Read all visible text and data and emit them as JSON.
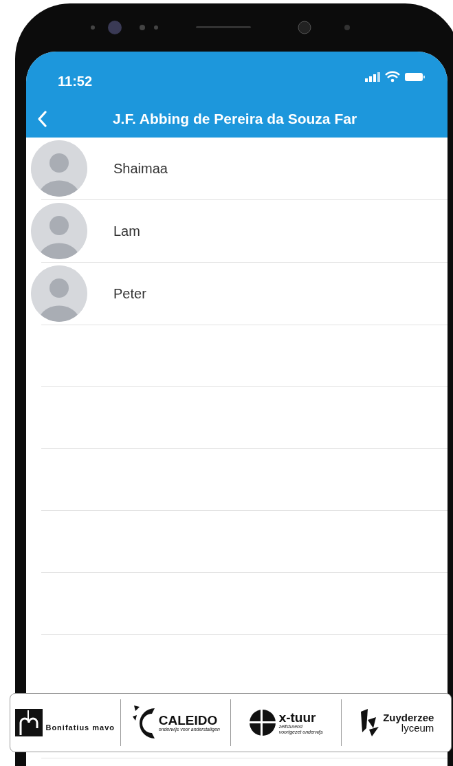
{
  "status_bar": {
    "time": "11:52"
  },
  "nav_bar": {
    "title": "J.F. Abbing de Pereira da Souza Far"
  },
  "contacts": [
    {
      "name": "Shaimaa"
    },
    {
      "name": "Lam"
    },
    {
      "name": "Peter"
    }
  ],
  "logos": [
    {
      "kind": "bonifatius",
      "texts": [
        "Bonifatius mavo"
      ]
    },
    {
      "kind": "caleido",
      "texts": [
        "CALEIDO",
        "onderwijs voor anderstaligen"
      ]
    },
    {
      "kind": "xtuur",
      "texts": [
        "x-tuur",
        "zelfsturend",
        "voortgezet onderwijs"
      ]
    },
    {
      "kind": "zuyderzee",
      "texts": [
        "Zuyderzee",
        "lyceum"
      ]
    }
  ]
}
